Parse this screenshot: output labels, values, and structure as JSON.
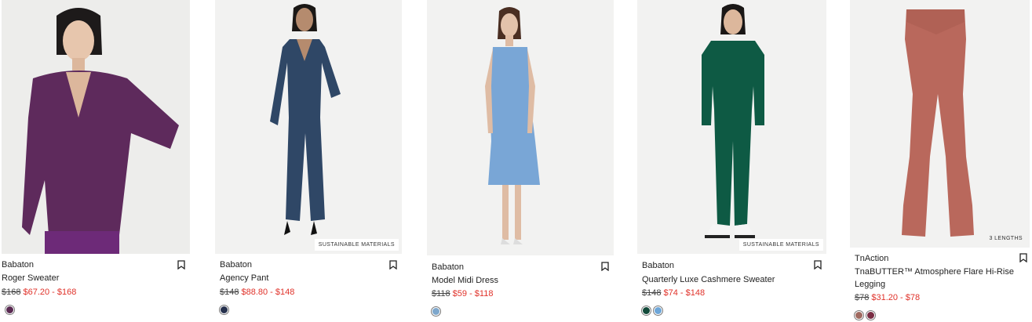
{
  "products": [
    {
      "brand": "Babaton",
      "name": "Roger Sweater",
      "original_price": "$168",
      "sale_price": "$67.20 - $168",
      "badge": "",
      "swatches": [
        "#5a2a52"
      ],
      "bookmark_icon": "bookmark-icon"
    },
    {
      "brand": "Babaton",
      "name": "Agency Pant",
      "original_price": "$148",
      "sale_price": "$88.80 - $148",
      "badge": "SUSTAINABLE MATERIALS",
      "swatches": [
        "#27324e"
      ],
      "bookmark_icon": "bookmark-icon"
    },
    {
      "brand": "Babaton",
      "name": "Model Midi Dress",
      "original_price": "$118",
      "sale_price": "$59 - $118",
      "badge": "",
      "swatches": [
        "#7ea7cc"
      ],
      "bookmark_icon": "bookmark-icon"
    },
    {
      "brand": "Babaton",
      "name": "Quarterly Luxe Cashmere Sweater",
      "original_price": "$148",
      "sale_price": "$74 - $148",
      "badge": "SUSTAINABLE MATERIALS",
      "swatches": [
        "#124a3a",
        "#6ea6d8"
      ],
      "bookmark_icon": "bookmark-icon"
    },
    {
      "brand": "TnAction",
      "name": "TnaBUTTER™ Atmosphere Flare Hi-Rise Legging",
      "original_price": "$78",
      "sale_price": "$31.20 - $78",
      "badge": "3 LENGTHS",
      "swatches": [
        "#a06a60",
        "#7a2e44"
      ],
      "bookmark_icon": "bookmark-icon"
    }
  ],
  "colors": {
    "sale": "#e0322a"
  }
}
